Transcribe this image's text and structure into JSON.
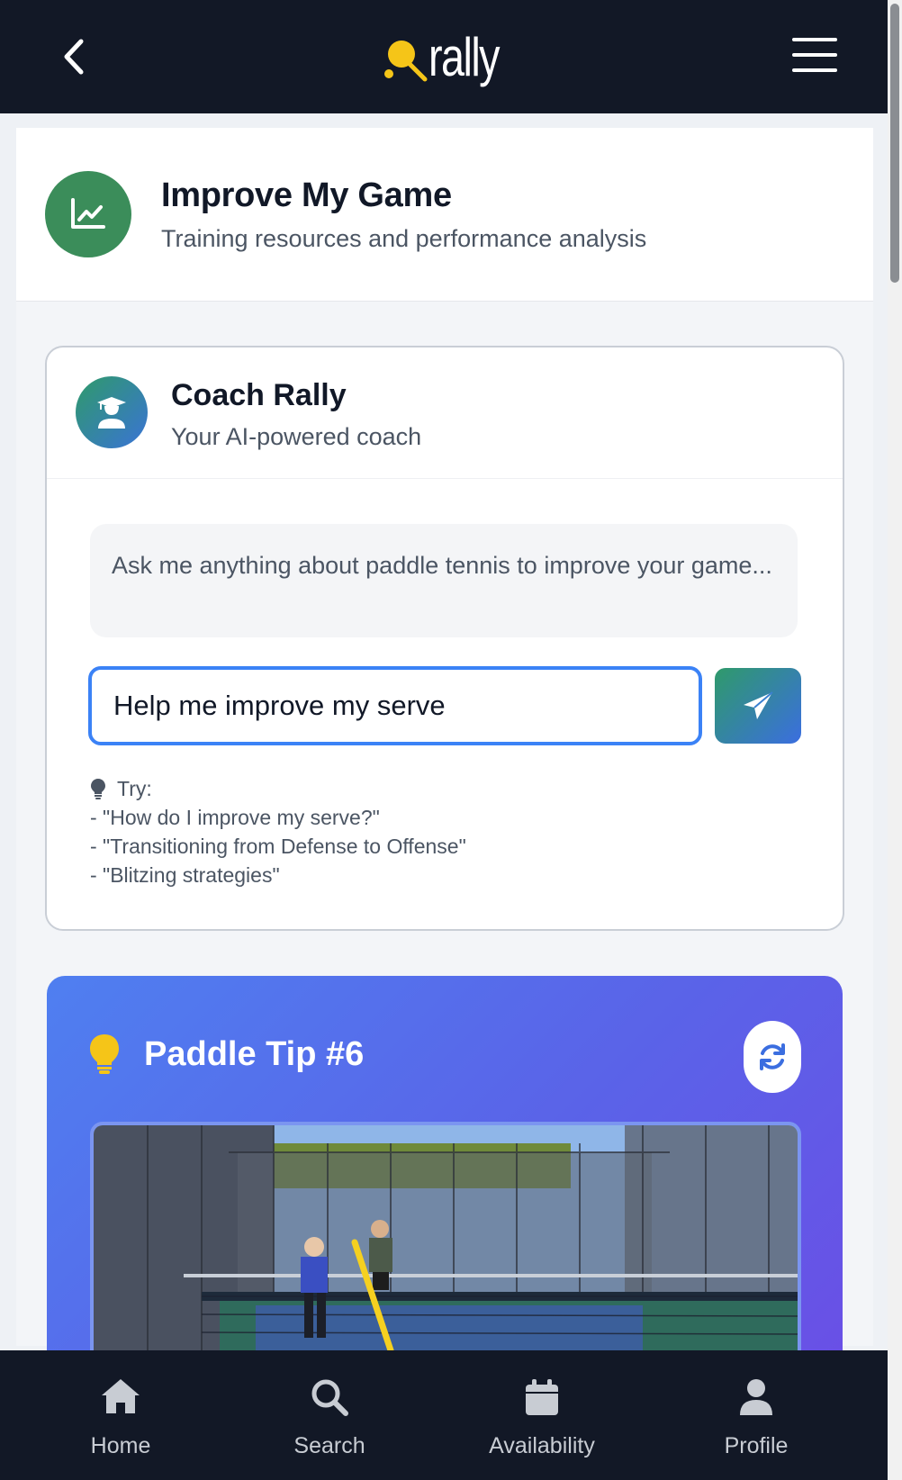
{
  "app": {
    "logo_text": "rally"
  },
  "page": {
    "title": "Improve My Game",
    "subtitle": "Training resources and performance analysis"
  },
  "coach": {
    "title": "Coach Rally",
    "subtitle": "Your AI-powered coach",
    "prompt": "Ask me anything about paddle tennis to improve your game...",
    "input_value": "Help me improve my serve",
    "tips_label": "Try:",
    "suggestions": [
      "- \"How do I improve my serve?\"",
      "- \"Transitioning from Defense to Offense\"",
      "- \"Blitzing strategies\""
    ]
  },
  "tip": {
    "title": "Paddle Tip #6"
  },
  "nav": {
    "home": "Home",
    "search": "Search",
    "availability": "Availability",
    "profile": "Profile"
  },
  "colors": {
    "header_bg": "#121826",
    "brand_yellow": "#f5c518",
    "heading_icon_bg": "#3b8d5a",
    "input_focus": "#3b82f6"
  }
}
